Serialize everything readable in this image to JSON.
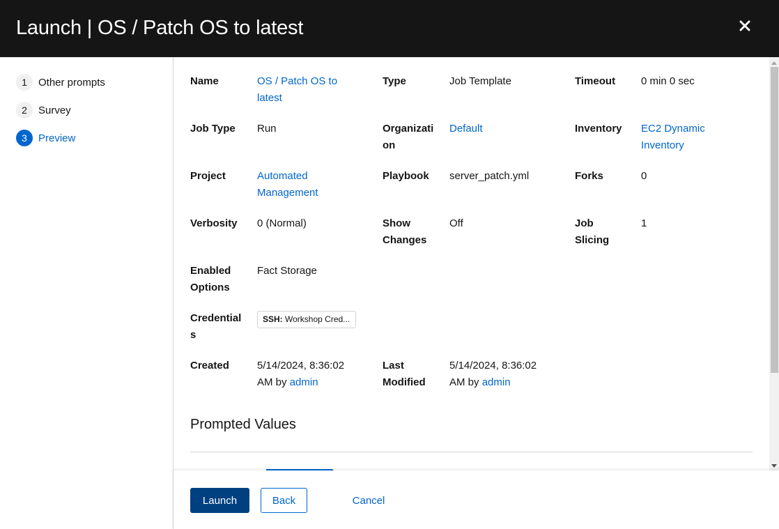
{
  "header": {
    "title": "Launch | OS / Patch OS to latest",
    "close_icon": "close-icon"
  },
  "wizard_nav": {
    "steps": [
      {
        "number": "1",
        "label": "Other prompts",
        "current": false
      },
      {
        "number": "2",
        "label": "Survey",
        "current": false
      },
      {
        "number": "3",
        "label": "Preview",
        "current": true
      }
    ]
  },
  "details": {
    "name": {
      "label": "Name",
      "value": "OS / Patch OS to latest",
      "link": true
    },
    "type": {
      "label": "Type",
      "value": "Job Template"
    },
    "timeout": {
      "label": "Timeout",
      "value": "0 min 0 sec"
    },
    "job_type": {
      "label": "Job Type",
      "value": "Run"
    },
    "organization": {
      "label": "Organization",
      "value": "Default",
      "link": true
    },
    "inventory": {
      "label": "Inventory",
      "value": "EC2 Dynamic Inventory",
      "link": true
    },
    "project": {
      "label": "Project",
      "value": "Automated Management",
      "link": true
    },
    "playbook": {
      "label": "Playbook",
      "value": "server_patch.yml"
    },
    "forks": {
      "label": "Forks",
      "value": "0"
    },
    "verbosity": {
      "label": "Verbosity",
      "value": "0 (Normal)"
    },
    "show_changes": {
      "label": "Show Changes",
      "value": "Off"
    },
    "job_slicing": {
      "label": "Job Slicing",
      "value": "1"
    },
    "enabled_options": {
      "label": "Enabled Options",
      "value": "Fact Storage"
    },
    "credentials": {
      "label": "Credentials",
      "chips": [
        {
          "kind": "SSH:",
          "name": "Workshop Cred..."
        }
      ]
    },
    "created": {
      "label": "Created",
      "date": "5/14/2024, 8:36:02 AM",
      "by_text": "by",
      "user": "admin"
    },
    "last_modified": {
      "label": "Last Modified",
      "date": "5/14/2024, 8:36:02 AM",
      "by_text": "by",
      "user": "admin"
    }
  },
  "prompted_values": {
    "title": "Prompted Values"
  },
  "footer": {
    "launch_label": "Launch",
    "back_label": "Back",
    "cancel_label": "Cancel"
  },
  "colors": {
    "header_bg": "#151515",
    "link": "#0066cc",
    "primary_button": "#004080",
    "current_step": "#0066cc"
  }
}
